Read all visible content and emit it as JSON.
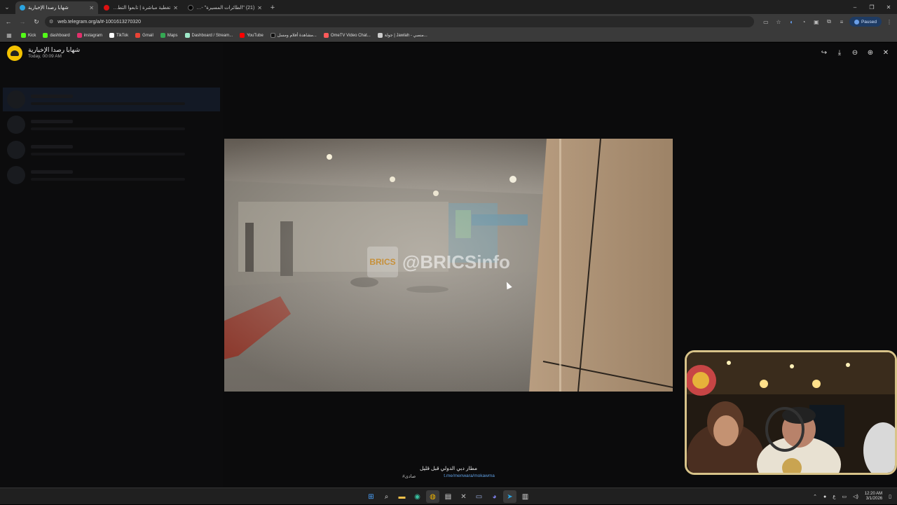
{
  "tabs": [
    {
      "title": "شهابا رصدا الإخبارية",
      "active": true,
      "favicon_color": "#2aa3e0"
    },
    {
      "title": "تغطية مباشرة | تابعوا التطورات",
      "active": false,
      "favicon_color": "#d11"
    },
    {
      "title": "(21) \"الطائرات المسيرة\" - X / ",
      "active": false,
      "favicon_color": "#000"
    }
  ],
  "new_tab_label": "+",
  "window_controls": {
    "minimize": "–",
    "maximize": "❐",
    "close": "✕"
  },
  "address": {
    "url": "web.telegram.org/a/#-1001613270320"
  },
  "profile_status": "Paused",
  "bookmarks": [
    {
      "label": "Kick",
      "color": "#53fc18"
    },
    {
      "label": "dashboard",
      "color": "#53fc18"
    },
    {
      "label": "instagram",
      "color": "#e1306c"
    },
    {
      "label": "TikTok",
      "color": "#ffffff"
    },
    {
      "label": "Gmail",
      "color": "#ea4335"
    },
    {
      "label": "Maps",
      "color": "#34a853"
    },
    {
      "label": "Dashboard / Stream...",
      "color": "#9ee8c8"
    },
    {
      "label": "YouTube",
      "color": "#ff0000"
    },
    {
      "label": "مشاهدة أفلام ومسل...",
      "color": "#111111"
    },
    {
      "label": "OmeTV Video Chat...",
      "color": "#ff5a5a"
    },
    {
      "label": "جولة | Jawlah - منصي...",
      "color": "#cccccc"
    }
  ],
  "viewer": {
    "channel_name": "شهابا رصدا الإخبارية",
    "date": "Today, 00:09 AM",
    "watermark": "@BRICSinfo",
    "watermark_logo": "BRICS"
  },
  "caption": {
    "text": "مطار دبي الدولي قبل قليل",
    "link": "t.me/menwara/mokawma",
    "tag": "#صادى"
  },
  "taskbar": {
    "time": "12:20 AM",
    "date": "3/1/2026",
    "lang": "ع"
  }
}
